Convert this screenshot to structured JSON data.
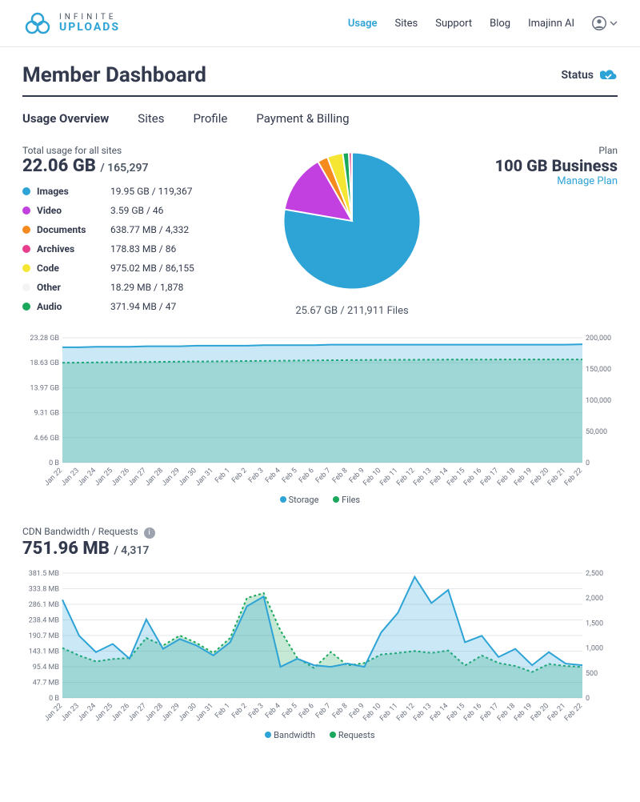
{
  "brand": {
    "top": "INFINITE",
    "bottom": "UPLOADS"
  },
  "nav": {
    "usage": "Usage",
    "sites": "Sites",
    "support": "Support",
    "blog": "Blog",
    "imajinn": "Imajinn AI"
  },
  "page": {
    "title": "Member Dashboard",
    "status_label": "Status"
  },
  "tabs": {
    "overview": "Usage Overview",
    "sites": "Sites",
    "profile": "Profile",
    "billing": "Payment & Billing"
  },
  "usage": {
    "label": "Total usage for all sites",
    "total_size": "22.06 GB",
    "total_count": "165,297",
    "categories": [
      {
        "name": "Images",
        "value": "19.95 GB / 119,367",
        "color": "#2DA3D6"
      },
      {
        "name": "Video",
        "value": "3.59 GB / 46",
        "color": "#C23FE0"
      },
      {
        "name": "Documents",
        "value": "638.77 MB / 4,332",
        "color": "#F58A1F"
      },
      {
        "name": "Archives",
        "value": "178.83 MB / 86",
        "color": "#E83E8C"
      },
      {
        "name": "Code",
        "value": "975.02 MB / 86,155",
        "color": "#F6E634"
      },
      {
        "name": "Other",
        "value": "18.29 MB / 1,878",
        "color": "#F3F4F6"
      },
      {
        "name": "Audio",
        "value": "371.94 MB / 47",
        "color": "#1BA85D"
      }
    ],
    "pie_caption": "25.67 GB / 211,911 Files"
  },
  "plan": {
    "label": "Plan",
    "name": "100 GB Business",
    "manage": "Manage Plan"
  },
  "storage_chart": {
    "legend": {
      "a": "Storage",
      "b": "Files"
    },
    "y_left": [
      "23.28 GB",
      "18.63 GB",
      "13.97 GB",
      "9.31 GB",
      "4.66 GB",
      "0 B"
    ],
    "y_right": [
      "200,000",
      "150,000",
      "100,000",
      "50,000",
      "0"
    ],
    "x": [
      "Jan 22",
      "Jan 23",
      "Jan 24",
      "Jan 25",
      "Jan 26",
      "Jan 27",
      "Jan 28",
      "Jan 29",
      "Jan 30",
      "Jan 31",
      "Feb 1",
      "Feb 2",
      "Feb 3",
      "Feb 4",
      "Feb 5",
      "Feb 6",
      "Feb 7",
      "Feb 8",
      "Feb 9",
      "Feb 10",
      "Feb 11",
      "Feb 12",
      "Feb 13",
      "Feb 14",
      "Feb 15",
      "Feb 16",
      "Feb 17",
      "Feb 18",
      "Feb 19",
      "Feb 20",
      "Feb 21",
      "Feb 22"
    ]
  },
  "cdn": {
    "label": "CDN Bandwidth / Requests",
    "total_bw": "751.96 MB",
    "total_req": "4,317",
    "legend": {
      "a": "Bandwidth",
      "b": "Requests"
    },
    "y_left": [
      "381.5 MB",
      "333.8 MB",
      "286.1 MB",
      "238.4 MB",
      "190.7 MB",
      "143.1 MB",
      "95.4 MB",
      "47.7 MB",
      "0 B"
    ],
    "y_right": [
      "2,500",
      "2,000",
      "1,500",
      "1,000",
      "500",
      "0"
    ],
    "x": [
      "Jan 22",
      "Jan 23",
      "Jan 24",
      "Jan 25",
      "Jan 26",
      "Jan 27",
      "Jan 28",
      "Jan 29",
      "Jan 30",
      "Jan 31",
      "Feb 1",
      "Feb 2",
      "Feb 3",
      "Feb 4",
      "Feb 5",
      "Feb 6",
      "Feb 7",
      "Feb 8",
      "Feb 9",
      "Feb 10",
      "Feb 11",
      "Feb 12",
      "Feb 13",
      "Feb 14",
      "Feb 15",
      "Feb 16",
      "Feb 17",
      "Feb 18",
      "Feb 19",
      "Feb 20",
      "Feb 21",
      "Feb 22"
    ]
  },
  "chart_data": [
    {
      "type": "pie",
      "title": "Storage usage by type",
      "categories": [
        "Images",
        "Video",
        "Documents",
        "Code",
        "Audio",
        "Archives",
        "Other"
      ],
      "values_gb": [
        19.95,
        3.59,
        0.624,
        0.952,
        0.363,
        0.175,
        0.018
      ],
      "file_counts": [
        119367,
        46,
        4332,
        86155,
        47,
        86,
        1878
      ],
      "total_gb": 25.67,
      "total_files": 211911
    },
    {
      "type": "area",
      "title": "Storage and Files over time",
      "x": [
        "Jan 22",
        "Jan 23",
        "Jan 24",
        "Jan 25",
        "Jan 26",
        "Jan 27",
        "Jan 28",
        "Jan 29",
        "Jan 30",
        "Jan 31",
        "Feb 1",
        "Feb 2",
        "Feb 3",
        "Feb 4",
        "Feb 5",
        "Feb 6",
        "Feb 7",
        "Feb 8",
        "Feb 9",
        "Feb 10",
        "Feb 11",
        "Feb 12",
        "Feb 13",
        "Feb 14",
        "Feb 15",
        "Feb 16",
        "Feb 17",
        "Feb 18",
        "Feb 19",
        "Feb 20",
        "Feb 21",
        "Feb 22"
      ],
      "series": [
        {
          "name": "Storage",
          "unit": "GB",
          "values": [
            21.5,
            21.5,
            21.6,
            21.6,
            21.6,
            21.7,
            21.7,
            21.7,
            21.8,
            21.8,
            21.8,
            21.8,
            21.9,
            21.9,
            21.9,
            21.9,
            22.0,
            22.0,
            22.0,
            22.0,
            22.0,
            22.0,
            22.0,
            22.0,
            22.0,
            22.0,
            22.0,
            22.0,
            22.0,
            22.0,
            22.0,
            22.06
          ]
        },
        {
          "name": "Files",
          "unit": "count",
          "values": [
            160000,
            160200,
            160500,
            160800,
            161000,
            161200,
            161500,
            161800,
            162000,
            162200,
            162500,
            162800,
            163000,
            163200,
            163500,
            163800,
            164000,
            164200,
            164400,
            164600,
            164700,
            164800,
            164900,
            165000,
            165050,
            165100,
            165150,
            165200,
            165230,
            165260,
            165280,
            165297
          ]
        }
      ],
      "ylim_left": [
        0,
        23.28
      ],
      "ylim_right": [
        0,
        200000
      ]
    },
    {
      "type": "area",
      "title": "CDN Bandwidth / Requests",
      "x": [
        "Jan 22",
        "Jan 23",
        "Jan 24",
        "Jan 25",
        "Jan 26",
        "Jan 27",
        "Jan 28",
        "Jan 29",
        "Jan 30",
        "Jan 31",
        "Feb 1",
        "Feb 2",
        "Feb 3",
        "Feb 4",
        "Feb 5",
        "Feb 6",
        "Feb 7",
        "Feb 8",
        "Feb 9",
        "Feb 10",
        "Feb 11",
        "Feb 12",
        "Feb 13",
        "Feb 14",
        "Feb 15",
        "Feb 16",
        "Feb 17",
        "Feb 18",
        "Feb 19",
        "Feb 20",
        "Feb 21",
        "Feb 22"
      ],
      "series": [
        {
          "name": "Bandwidth",
          "unit": "MB",
          "values": [
            300,
            190,
            140,
            165,
            120,
            240,
            150,
            180,
            160,
            130,
            170,
            280,
            310,
            95,
            120,
            100,
            95,
            105,
            95,
            200,
            260,
            370,
            290,
            330,
            170,
            190,
            125,
            150,
            100,
            140,
            105,
            100
          ]
        },
        {
          "name": "Requests",
          "unit": "count",
          "values": [
            1000,
            850,
            730,
            780,
            800,
            1200,
            1050,
            1250,
            1100,
            900,
            1200,
            2000,
            2100,
            1350,
            800,
            600,
            920,
            650,
            700,
            870,
            900,
            940,
            900,
            950,
            650,
            850,
            700,
            640,
            520,
            680,
            640,
            620
          ]
        }
      ],
      "ylim_left": [
        0,
        381.5
      ],
      "ylim_right": [
        0,
        2500
      ]
    }
  ]
}
